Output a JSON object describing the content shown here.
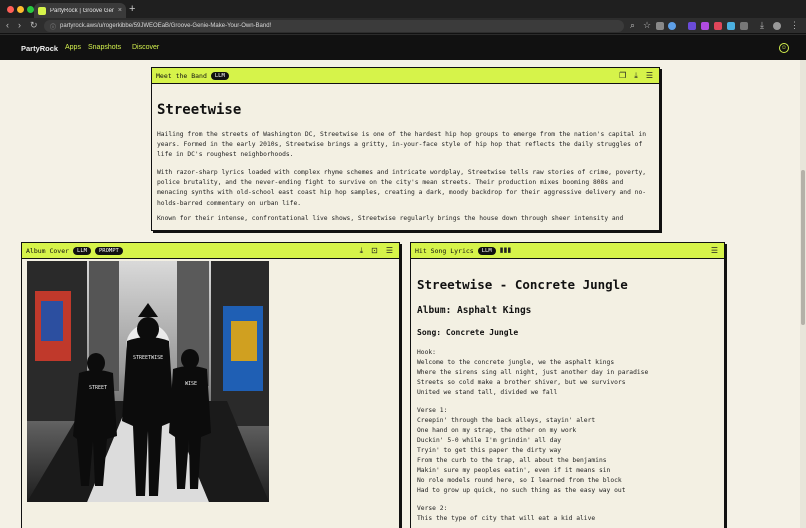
{
  "browser": {
    "tab_title": "PartyRock | Groove Genie - I",
    "tab_close": "×",
    "new_tab": "+",
    "url": "partyrock.aws/u/rogerkibbe/59JWEOEaB/Groove-Genie-Make-Your-Own-Band!",
    "icons": [
      "back-icon",
      "forward-icon",
      "reload-icon",
      "info-icon",
      "zoom-icon",
      "star-icon",
      "extension-icon",
      "download-icon",
      "profile-icon",
      "menu-icon"
    ]
  },
  "app": {
    "brand": "PartyRock",
    "nav": [
      "Apps",
      "Snapshots",
      "Discover"
    ],
    "accent": "#d6f34a"
  },
  "meet_band": {
    "title": "Meet the Band",
    "badge": "LLM",
    "heading": "Streetwise",
    "paragraphs": [
      "Hailing from the streets of Washington DC, Streetwise is one of the hardest hip hop groups to emerge from the nation's capital in years. Formed in the early 2010s, Streetwise brings a gritty, in-your-face style of hip hop that reflects the daily struggles of life in DC's roughest neighborhoods.",
      "With razor-sharp lyrics loaded with complex rhyme schemes and intricate wordplay, Streetwise tells raw stories of crime, poverty, police brutality, and the never-ending fight to survive on the city's mean streets. Their production mixes booming 808s and menacing synths with old-school east coast hip hop samples, creating a dark, moody backdrop for their aggressive delivery and no-holds-barred commentary on urban life.",
      "Known for their intense, confrontational live shows, Streetwise regularly brings the house down through sheer intensity and"
    ],
    "icons": [
      "copy-icon",
      "download-icon",
      "settings-icon"
    ]
  },
  "album_cover": {
    "title": "Album Cover",
    "badges": [
      "LLM",
      "PROMPT"
    ],
    "image_text": [
      "STREETWISE",
      "WISE",
      "STREET"
    ],
    "icons": [
      "download-icon",
      "save-icon",
      "settings-icon"
    ]
  },
  "hit_song": {
    "title": "Hit Song Lyrics",
    "badge": "LLM",
    "heading": "Streetwise - Concrete Jungle",
    "album": "Album: Asphalt Kings",
    "song": "Song: Concrete Jungle",
    "hook_label": "Hook:",
    "hook": [
      "Welcome to the concrete jungle, we the asphalt kings",
      "Where the sirens sing all night, just another day in paradise",
      "Streets so cold make a brother shiver, but we survivors",
      "United we stand tall, divided we fall"
    ],
    "verse1_label": "Verse 1:",
    "verse1": [
      "Creepin' through the back alleys, stayin' alert",
      "One hand on my strap, the other on my work",
      "Duckin' 5-0 while I'm grindin' all day",
      "Tryin' to get this paper the dirty way",
      "From the curb to the trap, all about the benjamins",
      "Makin' sure my peoples eatin', even if it means sin",
      "No role models round here, so I learned from the block",
      "Had to grow up quick, no such thing as the easy way out"
    ],
    "verse2_label": "Verse 2:",
    "verse2_partial": "This the type of city that will eat a kid alive",
    "icons": [
      "audio-wave-icon",
      "settings-icon"
    ]
  }
}
